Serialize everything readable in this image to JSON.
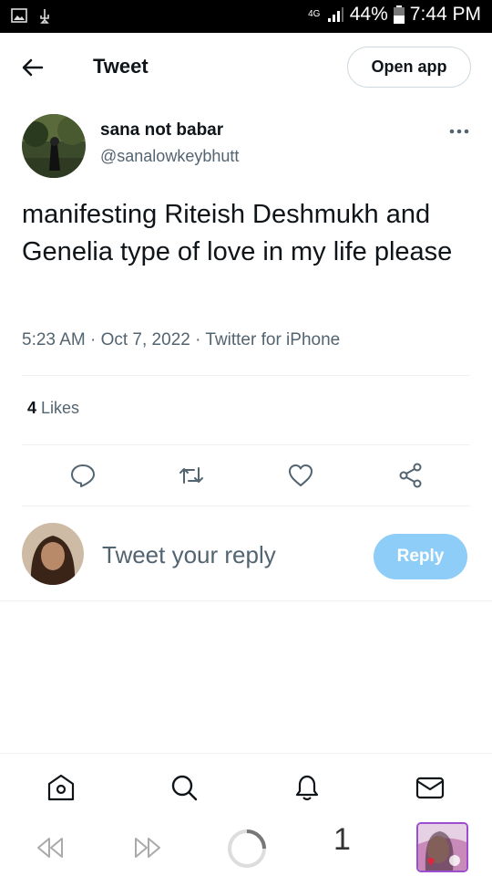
{
  "status_bar": {
    "network": "4G",
    "battery": "44%",
    "time": "7:44 PM"
  },
  "header": {
    "title": "Tweet",
    "open_app_label": "Open app"
  },
  "tweet": {
    "author_name": "sana not babar",
    "author_handle": "@sanalowkeybhutt",
    "text": "manifesting Riteish Deshmukh and Genelia type of love in my life please",
    "meta": "5:23 AM · Oct 7, 2022 · Twitter for iPhone",
    "likes_count": "4",
    "likes_label": "Likes"
  },
  "reply": {
    "placeholder": "Tweet your reply",
    "button_label": "Reply"
  },
  "browser": {
    "tab_count": "1"
  },
  "colors": {
    "accent_light": "#8ecdf8",
    "muted_text": "#536471",
    "border": "#cfd9de"
  },
  "icons": [
    "back-arrow-icon",
    "more-icon",
    "reply-icon",
    "retweet-icon",
    "like-icon",
    "share-icon",
    "home-icon",
    "search-icon",
    "notifications-icon",
    "messages-icon"
  ]
}
